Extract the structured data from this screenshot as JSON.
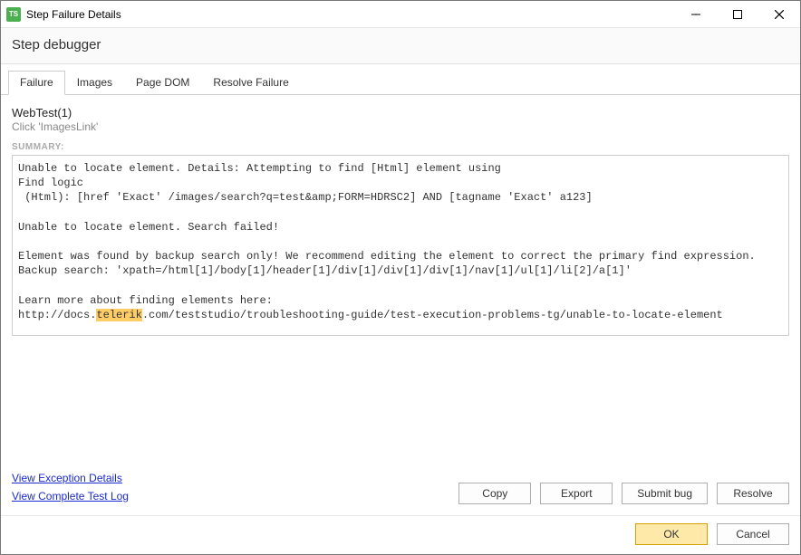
{
  "window": {
    "title": "Step Failure Details",
    "app_icon_text": "TS"
  },
  "subtitle": "Step debugger",
  "tabs": {
    "items": [
      "Failure",
      "Images",
      "Page DOM",
      "Resolve Failure"
    ],
    "active_index": 0
  },
  "test": {
    "name": "WebTest(1)",
    "step": "Click 'ImagesLink'"
  },
  "summary": {
    "label": "SUMMARY:",
    "pre1": "Unable to locate element. Details: Attempting to find [Html] element using\nFind logic\n (Html): [href 'Exact' /images/search?q=test&amp;FORM=HDRSC2] AND [tagname 'Exact' a123]\n\nUnable to locate element. Search failed!\n\nElement was found by backup search only! We recommend editing the element to correct the primary find expression.\nBackup search: 'xpath=/html[1]/body[1]/header[1]/div[1]/div[1]/div[1]/nav[1]/ul[1]/li[2]/a[1]'\n\nLearn more about finding elements here:\nhttp://docs.",
    "highlight": "telerik",
    "pre2": ".com/teststudio/troubleshooting-guide/test-execution-problems-tg/unable-to-locate-element"
  },
  "links": {
    "exception": "View Exception Details",
    "log": "View Complete Test Log"
  },
  "buttons": {
    "copy": "Copy",
    "export": "Export",
    "submit_bug": "Submit bug",
    "resolve": "Resolve",
    "ok": "OK",
    "cancel": "Cancel"
  }
}
